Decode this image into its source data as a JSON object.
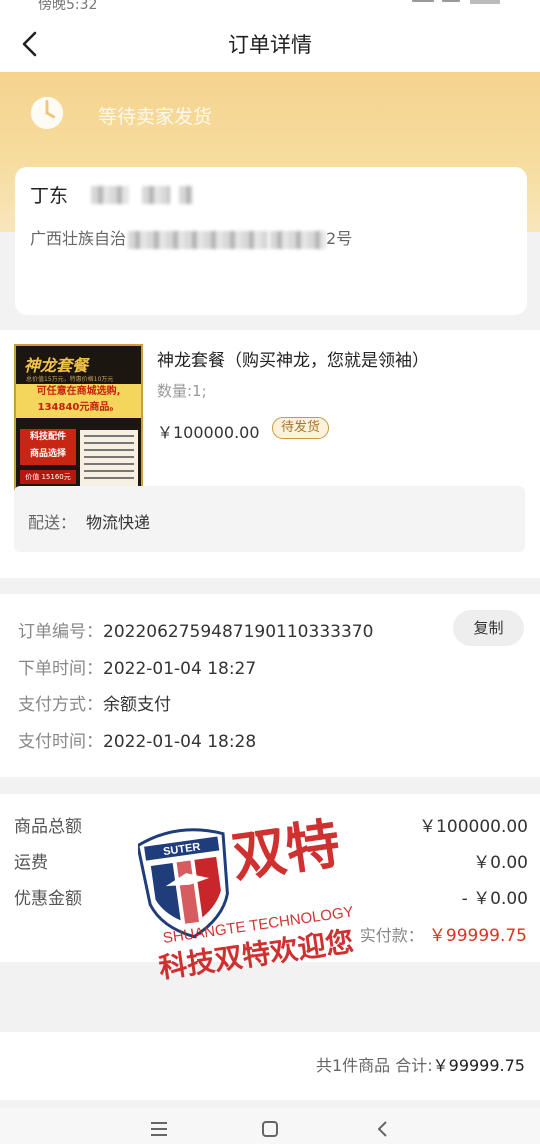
{
  "status_bar": {
    "time": "傍晚5:32"
  },
  "header": {
    "title": "订单详情"
  },
  "banner": {
    "status_text": "等待卖家发货"
  },
  "address": {
    "name": "丁东",
    "line_visible_start": "广西壮族自治",
    "line_visible_end": "2号"
  },
  "product": {
    "image_title": "神龙套餐",
    "image_subtitle": "总价值15万元，特惠价格10万元",
    "image_promo_line1": "可任意在商城选购,",
    "image_promo_line2": "134840元商品。",
    "image_red_label_line1": "科技配件",
    "image_red_label_line2": "商品选择",
    "image_price_tag": "价值 15160元",
    "name": "神龙套餐（购买神龙，您就是领袖）",
    "quantity": "数量:1;",
    "price": "￥100000.00",
    "status_badge": "待发货"
  },
  "delivery": {
    "label": "配送：",
    "value": "物流快递"
  },
  "order_info": {
    "order_no_label": "订单编号：",
    "order_no": "2022062759487190110333370",
    "copy_label": "复制",
    "created_label": "下单时间：",
    "created": "2022-01-04 18:27",
    "pay_method_label": "支付方式：",
    "pay_method": "余额支付",
    "pay_time_label": "支付时间：",
    "pay_time": "2022-01-04 18:28"
  },
  "summary": {
    "goods_total_label": "商品总额",
    "goods_total": "￥100000.00",
    "shipping_label": "运费",
    "shipping": "￥0.00",
    "discount_label": "优惠金额",
    "discount": "- ￥0.00",
    "actual_label": "实付款：",
    "actual": "￥99999.75"
  },
  "watermark": {
    "shield_text": "SUTER",
    "brand_cn": "双特",
    "brand_en": "SHUANGTE TECHNOLOGY",
    "slogan": "科技双特欢迎您"
  },
  "bottom": {
    "summary": "共1件商品 合计:",
    "total": "￥99999.75"
  },
  "colors": {
    "banner": "#f5d38e",
    "price_red": "#d8361f",
    "badge_border": "#c89a3e",
    "watermark_red": "#cc2020",
    "watermark_blue": "#1e3d7a"
  }
}
